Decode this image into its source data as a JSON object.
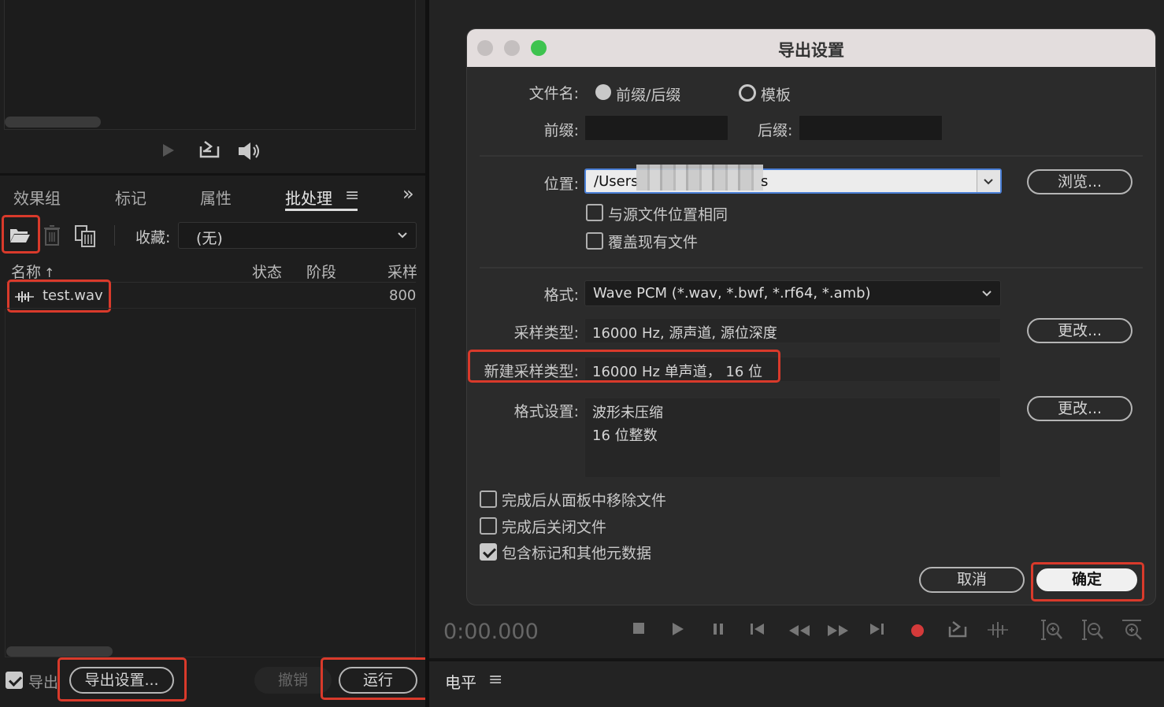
{
  "left_panel": {
    "tabs": [
      "效果组",
      "标记",
      "属性",
      "批处理"
    ],
    "active_tab": "批处理",
    "favorites_label": "收藏:",
    "favorites_value": "(无)",
    "columns": [
      "名称",
      "状态",
      "阶段",
      "采样"
    ],
    "files": [
      {
        "name": "test.wav",
        "rate": "800"
      }
    ],
    "export_checkbox_label": "导出",
    "export_settings_button": "导出设置...",
    "undo_button": "撤销",
    "run_button": "运行"
  },
  "dialog": {
    "title": "导出设置",
    "filename_label": "文件名:",
    "radio_prefix_suffix": "前缀/后缀",
    "radio_template": "模板",
    "prefix_label": "前缀:",
    "suffix_label": "后缀:",
    "location_label": "位置:",
    "location_value": "/Users",
    "location_tail": "s",
    "browse_button": "浏览...",
    "same_location_label": "与源文件位置相同",
    "overwrite_label": "覆盖现有文件",
    "format_label": "格式:",
    "format_value": "Wave PCM (*.wav, *.bwf, *.rf64, *.amb)",
    "sample_type_label": "采样类型:",
    "sample_type_value": "16000 Hz, 源声道, 源位深度",
    "change_button": "更改...",
    "new_sample_type_label": "新建采样类型:",
    "new_sample_type_value": "16000 Hz 单声道， 16 位",
    "format_settings_label": "格式设置:",
    "format_settings_lines": [
      "波形未压缩",
      "16 位整数"
    ],
    "remove_after_label": "完成后从面板中移除文件",
    "close_after_label": "完成后关闭文件",
    "include_markers_label": "包含标记和其他元数据",
    "cancel_button": "取消",
    "ok_button": "确定"
  },
  "transport": {
    "time": "0:00.000"
  },
  "level_panel": {
    "title": "电平"
  },
  "colors": {
    "accent_red": "#d93a2b",
    "record_red": "#e23c3c",
    "dialog_bg": "#2b2b2b",
    "titlebar_bg": "#e3dddd"
  }
}
